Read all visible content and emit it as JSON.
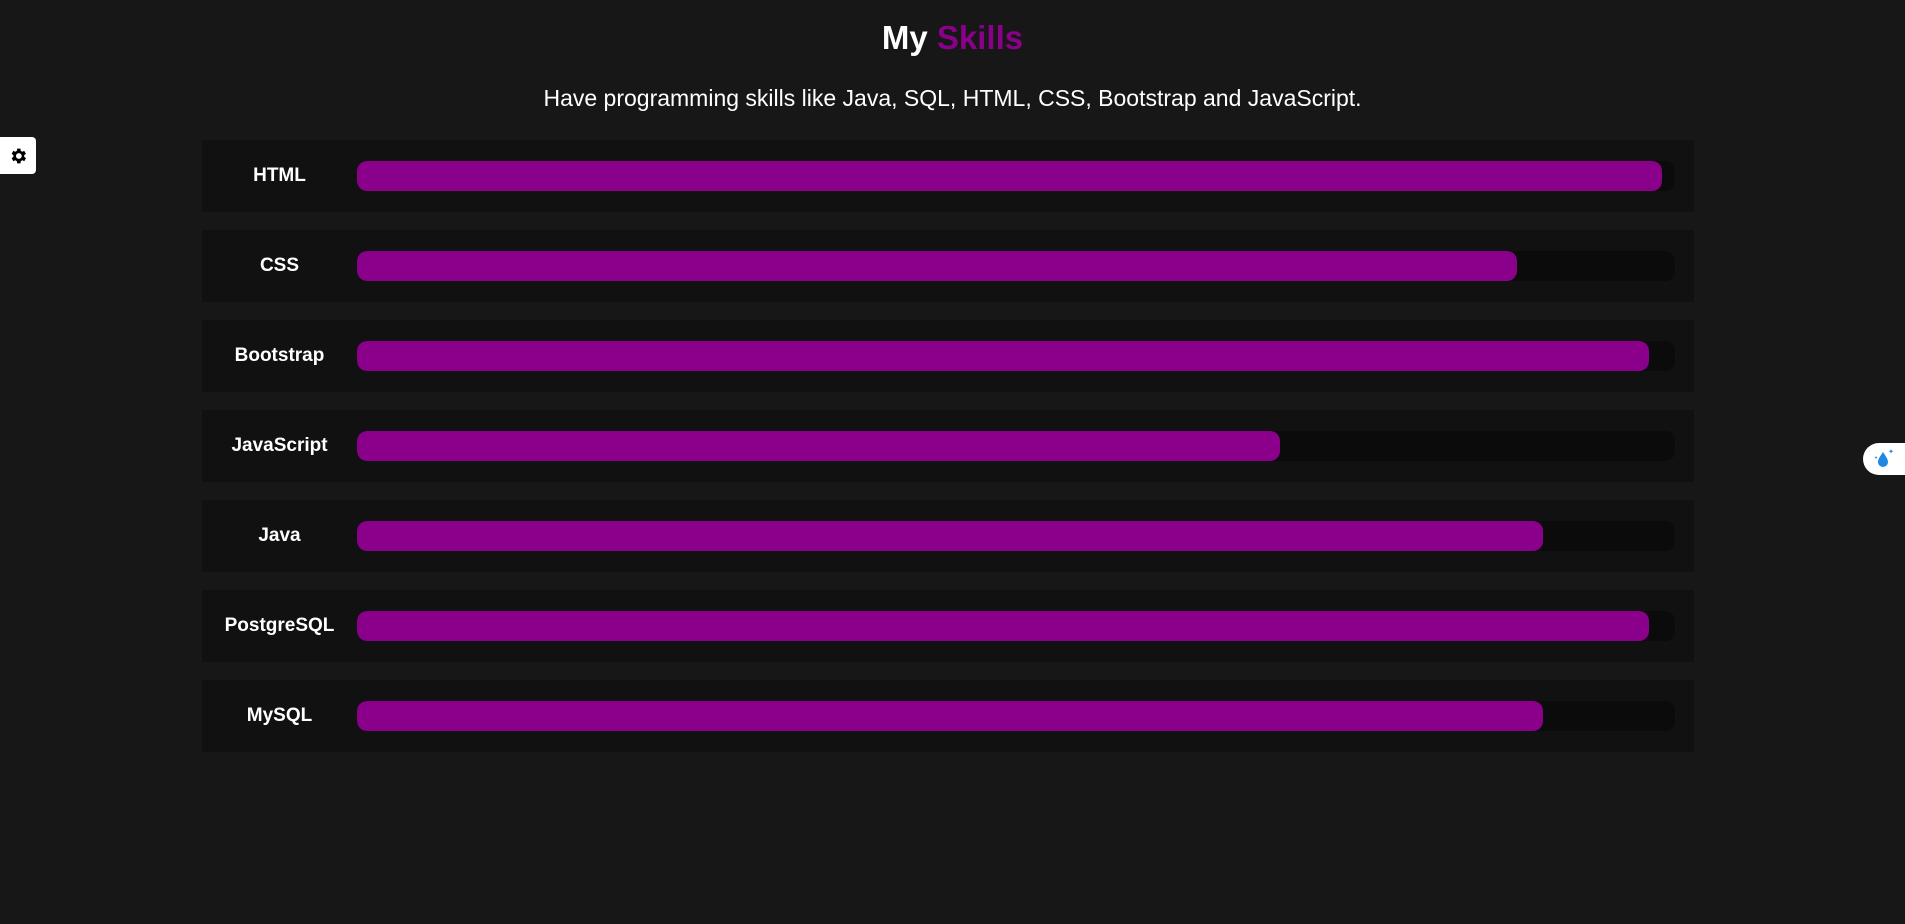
{
  "header": {
    "title_part1": "My",
    "title_part2": "Skills",
    "subtitle": "Have programming skills like Java, SQL, HTML, CSS, Bootstrap and JavaScript."
  },
  "colors": {
    "accent": "#8b008b",
    "background": "#171717",
    "row_background": "#111111",
    "track": "#0b0b0b"
  },
  "icons": {
    "settings": "gear-icon",
    "widget": "water-drop-icon"
  },
  "skills": [
    {
      "label": "HTML",
      "level": 0.99
    },
    {
      "label": "CSS",
      "level": 0.88
    },
    {
      "label": "Bootstrap",
      "level": 0.98
    },
    {
      "label": "JavaScript",
      "level": 0.7
    },
    {
      "label": "Java",
      "level": 0.9
    },
    {
      "label": "PostgreSQL",
      "level": 0.98
    },
    {
      "label": "MySQL",
      "level": 0.9
    }
  ]
}
